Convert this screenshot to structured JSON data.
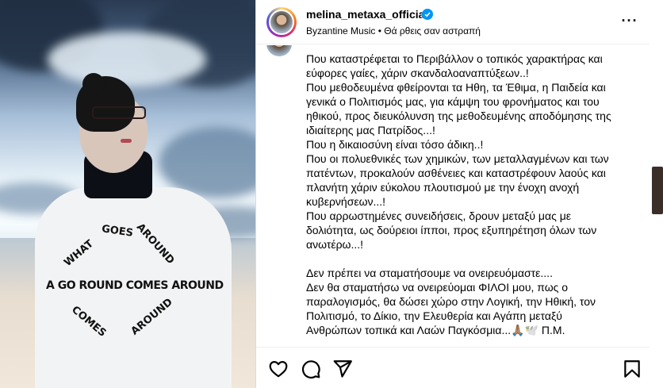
{
  "photo": {
    "shirt_words": [
      "GOES",
      "WHAT",
      "AROUND",
      "A GO ROUND COMES AROUND",
      "COMES",
      "AROUND"
    ]
  },
  "header": {
    "username": "melina_metaxa_official",
    "subtitle": "Byzantine Music • Θά ρθεις σαν αστραπή",
    "verified_icon": "verified-badge-icon",
    "more_icon": "more-options-icon"
  },
  "caption": {
    "lines": [
      "Που καταστρέφεται το Περιβάλλον ο τοπικός χαρακτήρας και",
      "εύφορες γαίες, χάριν σκανδαλοαναπτύξεων..!",
      "Που μεθοδευμένα φθείρονται τα Ηθη, τα Έθιμα, η Παιδεία και",
      "γενικά ο Πολιτισμός μας, για κάμψη του φρονήματος και του",
      "ηθικού, προς διευκόλυνση της μεθοδευμένης αποδόμησης της",
      "ιδιαίτερης μας Πατρίδος...!",
      "Που η δικαιοσύνη είναι τόσο άδικη..!",
      "Που οι πολυεθνικές των χημικών, των μεταλλαγμένων και των",
      "πατέντων, προκαλούν ασθένειες και καταστρέφουν λαούς και",
      "πλανήτη χάριν εύκολου πλουτισμού με την ένοχη ανοχή",
      "κυβερνήσεων...!",
      "Που αρρωστημένες συνειδήσεις, δρουν μεταξύ μας με",
      "δολιότητα, ως δούρειοι ίπποι, προς εξυπηρέτηση όλων των",
      "ανωτέρω...!",
      "",
      "Δεν πρέπει να σταματήσουμε να ονειρευόμαστε....",
      "Δεν θα σταματήσω να ονειρεύομαι ΦΙΛΟΙ μου, πως ο",
      "παραλογισμός, θα δώσει χώρο στην Λογική, την Ηθική, τον",
      "Πολιτισμό, το Δίκιο, την Ελευθερία και Αγάπη μεταξύ",
      "Ανθρώπων τοπικά και Λαών Παγκόσμια...🙏🏽🕊️ Π.Μ."
    ]
  },
  "actions": {
    "like_icon": "heart-icon",
    "comment_icon": "comment-icon",
    "share_icon": "share-icon",
    "save_icon": "bookmark-icon"
  },
  "colors": {
    "verified": "#0095f6",
    "border": "#dbdbdb"
  }
}
